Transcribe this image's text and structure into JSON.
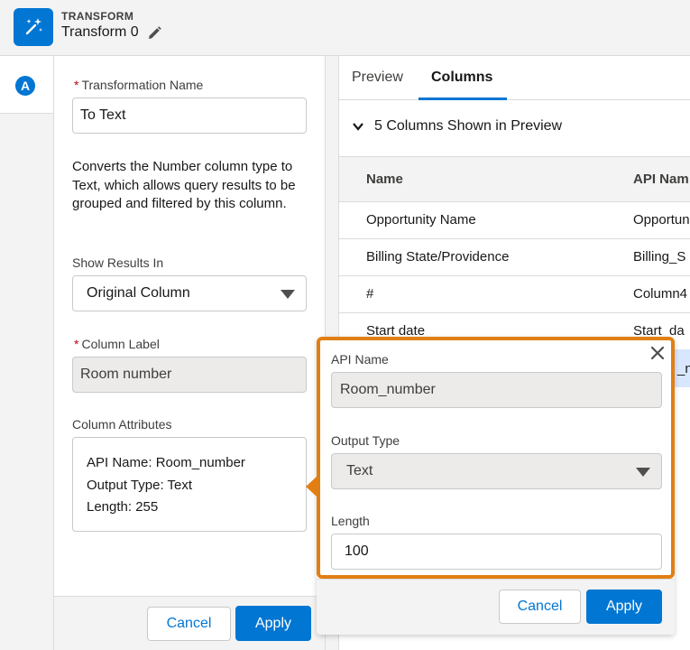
{
  "header": {
    "kicker": "TRANSFORM",
    "title": "Transform 0"
  },
  "form": {
    "name_label": "Transformation Name",
    "name_value": "To Text",
    "description": "Converts the Number column type to Text, which allows query results to be grouped and filtered by this column.",
    "show_results_label": "Show Results In",
    "show_results_value": "Original Column",
    "column_label_label": "Column Label",
    "column_label_value": "Room number",
    "attributes_label": "Column Attributes",
    "attributes": {
      "api_name": "API Name: Room_number",
      "output_type": "Output Type: Text",
      "length": "Length: 255"
    },
    "cancel_label": "Cancel",
    "apply_label": "Apply"
  },
  "rail": {
    "logo_letter": "A"
  },
  "preview": {
    "tabs": [
      "Preview",
      "Columns"
    ],
    "active_tab": "Columns",
    "section_title": "5 Columns Shown in Preview",
    "columns": [
      "Name",
      "API Nam"
    ],
    "rows": [
      [
        "Opportunity Name",
        "Opportun"
      ],
      [
        "Billing State/Providence",
        "Billing_S"
      ],
      [
        "#",
        "Column4"
      ],
      [
        "Start date",
        "Start_da"
      ],
      [
        "",
        "_nu"
      ]
    ]
  },
  "popover": {
    "api_name_label": "API Name",
    "api_name_value": "Room_number",
    "output_type_label": "Output Type",
    "output_type_value": "Text",
    "length_label": "Length",
    "length_value": "100",
    "cancel_label": "Cancel",
    "apply_label": "Apply"
  },
  "colors": {
    "brand": "#0176d3",
    "highlight": "#e17f14",
    "required": "#ba0517"
  }
}
